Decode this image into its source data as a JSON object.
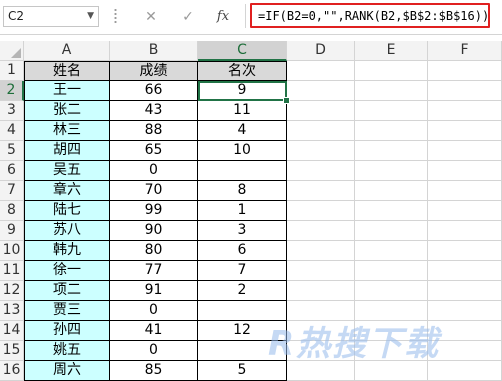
{
  "formula_bar": {
    "name_box": "C2",
    "cancel_glyph": "✕",
    "enter_glyph": "✓",
    "fx_label": "fx",
    "formula": "=IF(B2=0,\"\",RANK(B2,$B$2:$B$16))"
  },
  "columns": [
    "A",
    "B",
    "C",
    "D",
    "E",
    "F"
  ],
  "rows": [
    {
      "num": "1",
      "a": "姓名",
      "b": "成绩",
      "c": "名次"
    },
    {
      "num": "2",
      "a": "王一",
      "b": "66",
      "c": "9"
    },
    {
      "num": "3",
      "a": "张二",
      "b": "43",
      "c": "11"
    },
    {
      "num": "4",
      "a": "林三",
      "b": "88",
      "c": "4"
    },
    {
      "num": "5",
      "a": "胡四",
      "b": "65",
      "c": "10"
    },
    {
      "num": "6",
      "a": "吴五",
      "b": "0",
      "c": ""
    },
    {
      "num": "7",
      "a": "章六",
      "b": "70",
      "c": "8"
    },
    {
      "num": "8",
      "a": "陆七",
      "b": "99",
      "c": "1"
    },
    {
      "num": "9",
      "a": "苏八",
      "b": "90",
      "c": "3"
    },
    {
      "num": "10",
      "a": "韩九",
      "b": "80",
      "c": "6"
    },
    {
      "num": "11",
      "a": "徐一",
      "b": "77",
      "c": "7"
    },
    {
      "num": "12",
      "a": "项二",
      "b": "91",
      "c": "2"
    },
    {
      "num": "13",
      "a": "贾三",
      "b": "0",
      "c": ""
    },
    {
      "num": "14",
      "a": "孙四",
      "b": "41",
      "c": "12"
    },
    {
      "num": "15",
      "a": "姚五",
      "b": "0",
      "c": ""
    },
    {
      "num": "16",
      "a": "周六",
      "b": "85",
      "c": "5"
    }
  ],
  "watermark": "R热搜下载",
  "colors": {
    "accent": "#217346",
    "formula_highlight": "#e02020",
    "name_col_fill": "#ccffff",
    "header_fill": "#d9d9d9"
  }
}
